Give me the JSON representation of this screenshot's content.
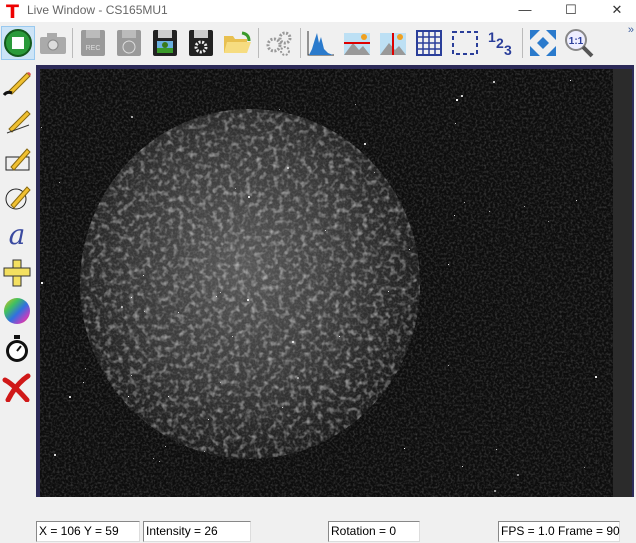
{
  "window": {
    "title": "Live Window - CS165MU1",
    "app_logo": "T"
  },
  "toolbar": {
    "items": [
      "stop-live",
      "snapshot",
      "record",
      "timed-capture",
      "save-image",
      "save-settings",
      "open-file",
      "camera-settings",
      "histogram",
      "line-profile-horizontal",
      "line-profile-vertical",
      "grid",
      "roi",
      "numbers",
      "fit-to-window",
      "zoom-1-1"
    ],
    "more": "»"
  },
  "left_tools": [
    "freehand-pencil",
    "line-pencil",
    "rectangle-pencil",
    "ellipse-pencil",
    "text",
    "ruler",
    "color-wheel",
    "stopwatch",
    "delete"
  ],
  "status": {
    "coords": "X = 106  Y = 59",
    "intensity": "Intensity = 26",
    "rotation": "Rotation = 0",
    "fps": "FPS = 1.0  Frame = 90"
  },
  "colors": {
    "frame": "#2c2a58",
    "image_bg": "#0d0d0d",
    "accent_blue": "#2a3e9a"
  }
}
